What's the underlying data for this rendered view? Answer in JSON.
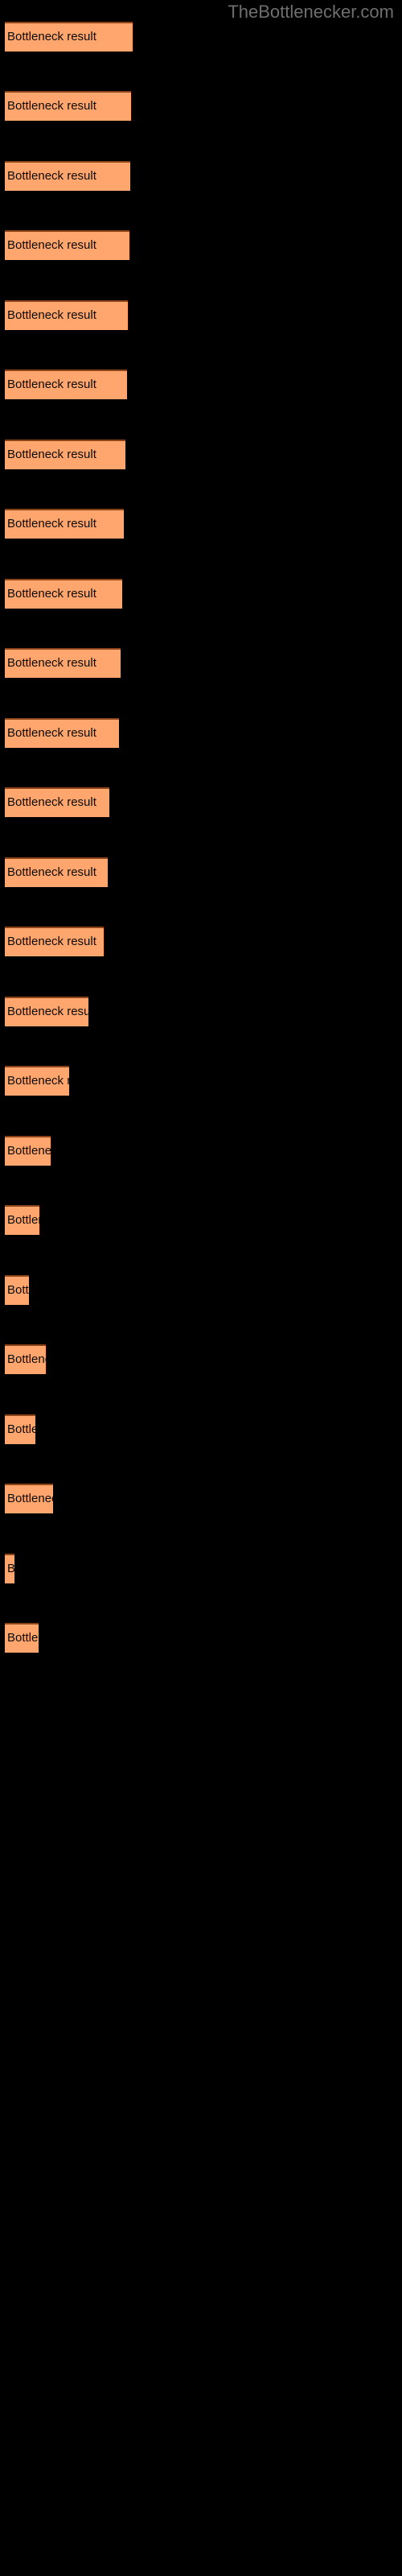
{
  "watermark": "TheBottlenecker.com",
  "background_color": "#000000",
  "bar_color": "#ffa66e",
  "bar_border_color": "#8a4418",
  "label_color": "#0b0b0b",
  "watermark_color": "#6e6e6e",
  "bar_label": "Bottleneck result",
  "chart_data": {
    "type": "bar",
    "orientation": "horizontal",
    "title": "TheBottlenecker.com",
    "xlabel": "",
    "ylabel": "",
    "grid": false,
    "legend": null,
    "categories": [
      "Bottleneck result",
      "Bottleneck result",
      "Bottleneck result",
      "Bottleneck result",
      "Bottleneck result",
      "Bottleneck result",
      "Bottleneck result",
      "Bottleneck result",
      "Bottleneck result",
      "Bottleneck result",
      "Bottleneck result",
      "Bottleneck result",
      "Bottleneck result",
      "Bottleneck result",
      "Bottleneck result",
      "Bottleneck result",
      "Bottleneck result",
      "Bottleneck result",
      "Bottleneck result",
      "Bottleneck result",
      "Bottleneck result",
      "Bottleneck result",
      "Bottleneck result",
      "Bottleneck result"
    ],
    "values": [
      159,
      157,
      156,
      155,
      153,
      152,
      150,
      148,
      146,
      144,
      142,
      130,
      128,
      123,
      104,
      80,
      57,
      43,
      30,
      51,
      38,
      60,
      12,
      42
    ],
    "xlim": [
      0,
      500
    ]
  },
  "bars": [
    {
      "label": "Bottleneck result",
      "width": 159,
      "top": 27
    },
    {
      "label": "Bottleneck result",
      "width": 157,
      "top": 113
    },
    {
      "label": "Bottleneck result",
      "width": 156,
      "top": 200
    },
    {
      "label": "Bottleneck result",
      "width": 155,
      "top": 286
    },
    {
      "label": "Bottleneck result",
      "width": 153,
      "top": 373
    },
    {
      "label": "Bottleneck result",
      "width": 152,
      "top": 459
    },
    {
      "label": "Bottleneck result",
      "width": 150,
      "top": 546
    },
    {
      "label": "Bottleneck result",
      "width": 148,
      "top": 632
    },
    {
      "label": "Bottleneck result",
      "width": 146,
      "top": 719
    },
    {
      "label": "Bottleneck result",
      "width": 144,
      "top": 805
    },
    {
      "label": "Bottleneck result",
      "width": 142,
      "top": 892
    },
    {
      "label": "Bottleneck result",
      "width": 130,
      "top": 978
    },
    {
      "label": "Bottleneck result",
      "width": 128,
      "top": 1065
    },
    {
      "label": "Bottleneck result",
      "width": 123,
      "top": 1151
    },
    {
      "label": "Bottleneck result",
      "width": 104,
      "top": 1238
    },
    {
      "label": "Bottleneck result",
      "width": 80,
      "top": 1324
    },
    {
      "label": "Bottleneck result",
      "width": 57,
      "top": 1411
    },
    {
      "label": "Bottleneck result",
      "width": 43,
      "top": 1497
    },
    {
      "label": "Bottleneck result",
      "width": 30,
      "top": 1584
    },
    {
      "label": "Bottleneck result",
      "width": 51,
      "top": 1670
    },
    {
      "label": "Bottleneck result",
      "width": 38,
      "top": 1757
    },
    {
      "label": "Bottleneck result",
      "width": 60,
      "top": 1843
    },
    {
      "label": "Bottleneck result",
      "width": 12,
      "top": 1930
    },
    {
      "label": "Bottleneck result",
      "width": 42,
      "top": 2016
    }
  ]
}
